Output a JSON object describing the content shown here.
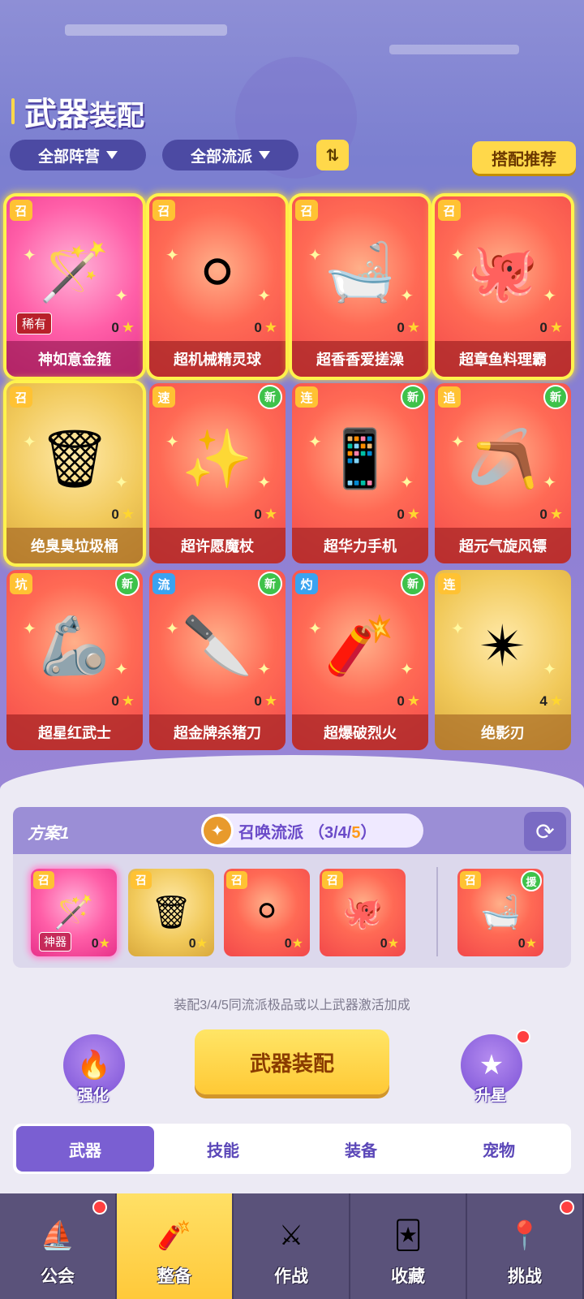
{
  "header": {
    "title_part1": "武器",
    "title_part2": "装配",
    "filter_camp": "全部阵营",
    "filter_school": "全部流派",
    "sort_icon": "⇅",
    "recommend_label": "搭配推荐"
  },
  "weapons": [
    {
      "name": "神如意金箍",
      "tag": "召",
      "count": "0",
      "rare": "稀有",
      "theme": "pink",
      "highlight": true,
      "icon": "golden-staff-icon"
    },
    {
      "name": "超机械精灵球",
      "tag": "召",
      "count": "0",
      "theme": "red",
      "highlight": true,
      "icon": "pokeball-icon"
    },
    {
      "name": "超香香爱搓澡",
      "tag": "召",
      "count": "0",
      "theme": "red",
      "highlight": true,
      "icon": "bathtub-duck-icon"
    },
    {
      "name": "超章鱼料理霸",
      "tag": "召",
      "count": "0",
      "theme": "red",
      "highlight": true,
      "icon": "octopus-icon"
    },
    {
      "name": "绝臭臭垃圾桶",
      "tag": "召",
      "count": "0",
      "theme": "gold",
      "highlight": true,
      "icon": "trash-bin-icon"
    },
    {
      "name": "超许愿魔杖",
      "tag": "速",
      "count": "0",
      "theme": "red",
      "new": "新",
      "icon": "magic-wand-icon"
    },
    {
      "name": "超华力手机",
      "tag": "连",
      "count": "0",
      "theme": "red",
      "new": "新",
      "icon": "phone-icon"
    },
    {
      "name": "超元气旋风镖",
      "tag": "追",
      "count": "0",
      "theme": "red",
      "new": "新",
      "icon": "boomerang-icon"
    },
    {
      "name": "超星红武士",
      "tag": "坑",
      "count": "0",
      "theme": "red",
      "new": "新",
      "icon": "robot-arm-icon"
    },
    {
      "name": "超金牌杀猪刀",
      "tag": "流",
      "count": "0",
      "theme": "red",
      "new": "新",
      "icon": "cleaver-icon"
    },
    {
      "name": "超爆破烈火",
      "tag": "灼",
      "count": "0",
      "theme": "red",
      "new": "新",
      "icon": "explosive-box-icon"
    },
    {
      "name": "绝影刃",
      "tag": "连",
      "count": "4",
      "theme": "gold",
      "icon": "shuriken-icon"
    }
  ],
  "plan": {
    "name": "方案1",
    "school_label": "召唤流派",
    "progress_prefix": "（3/4/",
    "progress_hi": "5",
    "progress_suffix": "）",
    "slots": [
      {
        "tag": "召",
        "count": "0",
        "badge": "神器",
        "theme": "pink",
        "icon": "golden-staff-icon"
      },
      {
        "tag": "召",
        "count": "0",
        "theme": "gold",
        "icon": "trash-bin-icon"
      },
      {
        "tag": "召",
        "count": "0",
        "theme": "red",
        "icon": "pokeball-icon"
      },
      {
        "tag": "召",
        "count": "0",
        "theme": "red",
        "icon": "octopus-icon"
      }
    ],
    "assist_slot": {
      "tag": "召",
      "count": "0",
      "help": "援",
      "theme": "red",
      "icon": "bathtub-duck-icon"
    }
  },
  "hint": "装配3/4/5同流派极品或以上武器激活加成",
  "actions": {
    "strengthen": "强化",
    "equip": "武器装配",
    "star_up": "升星"
  },
  "tabs": [
    "武器",
    "技能",
    "装备",
    "宠物"
  ],
  "nav": [
    {
      "label": "公会",
      "icon": "ship-icon",
      "dot": true
    },
    {
      "label": "整备",
      "icon": "dynamite-box-icon",
      "active": true
    },
    {
      "label": "作战",
      "icon": "crossed-swords-icon"
    },
    {
      "label": "收藏",
      "icon": "cards-icon"
    },
    {
      "label": "挑战",
      "icon": "map-pin-icon",
      "dot": true
    }
  ],
  "colors": {
    "accent_yellow": "#ffd84a",
    "purple": "#7a5fd2",
    "card_red": "#f2484a",
    "card_gold": "#d9a93c",
    "card_pink": "#e8318a"
  }
}
